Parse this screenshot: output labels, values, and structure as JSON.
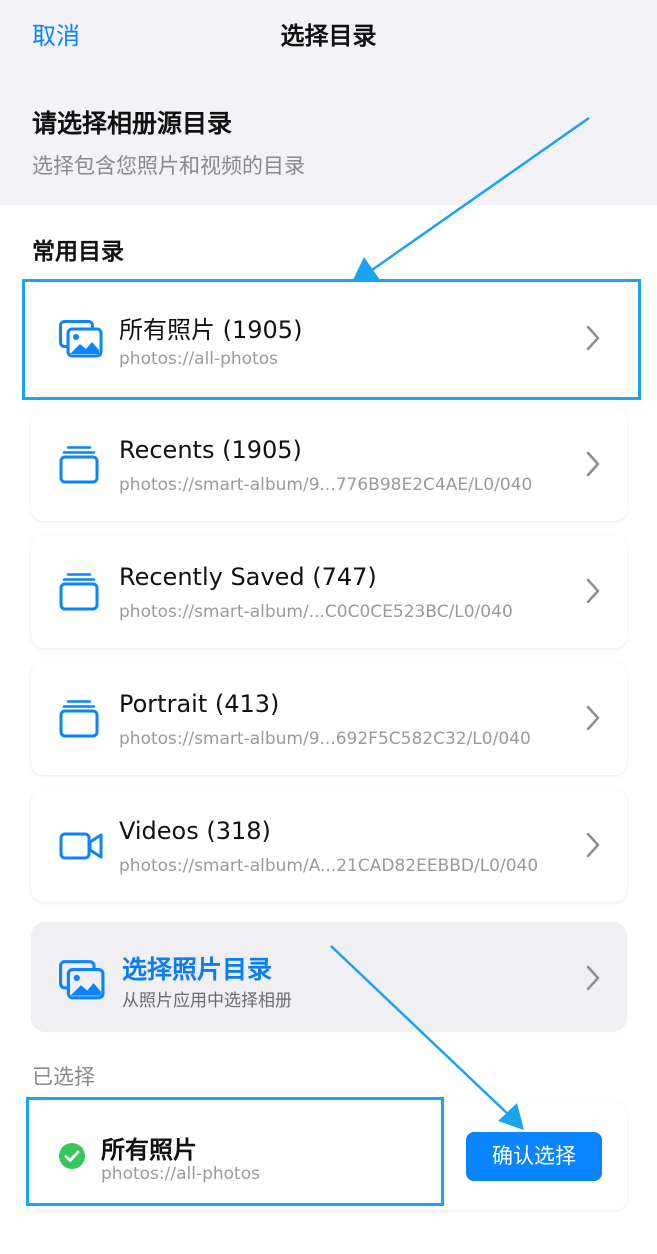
{
  "nav": {
    "cancel_label": "取消",
    "title": "选择目录"
  },
  "intro": {
    "heading": "请选择相册源目录",
    "subheading": "选择包含您照片和视频的目录"
  },
  "common": {
    "section_title": "常用目录",
    "items": [
      {
        "icon": "photo-icon",
        "name": "所有照片 (1905)",
        "path": "photos://all-photos"
      },
      {
        "icon": "album-stack-icon",
        "name": "Recents (1905)",
        "path": "photos://smart-album/9...776B98E2C4AE/L0/040"
      },
      {
        "icon": "album-stack-icon",
        "name": "Recently Saved (747)",
        "path": "photos://smart-album/...C0C0CE523BC/L0/040"
      },
      {
        "icon": "album-stack-icon",
        "name": "Portrait (413)",
        "path": "photos://smart-album/9...692F5C582C32/L0/040"
      },
      {
        "icon": "video-icon",
        "name": "Videos (318)",
        "path": "photos://smart-album/A...21CAD82EEBBD/L0/040"
      }
    ]
  },
  "picker": {
    "icon": "photo-icon",
    "name": "选择照片目录",
    "subtitle": "从照片应用中选择相册"
  },
  "selected": {
    "label": "已选择",
    "name": "所有照片",
    "path": "photos://all-photos",
    "confirm_label": "确认选择"
  },
  "colors": {
    "accent": "#0a84ff",
    "highlight": "#1aa3ee",
    "check": "#34c759",
    "header_bg": "#f2f2f7"
  }
}
